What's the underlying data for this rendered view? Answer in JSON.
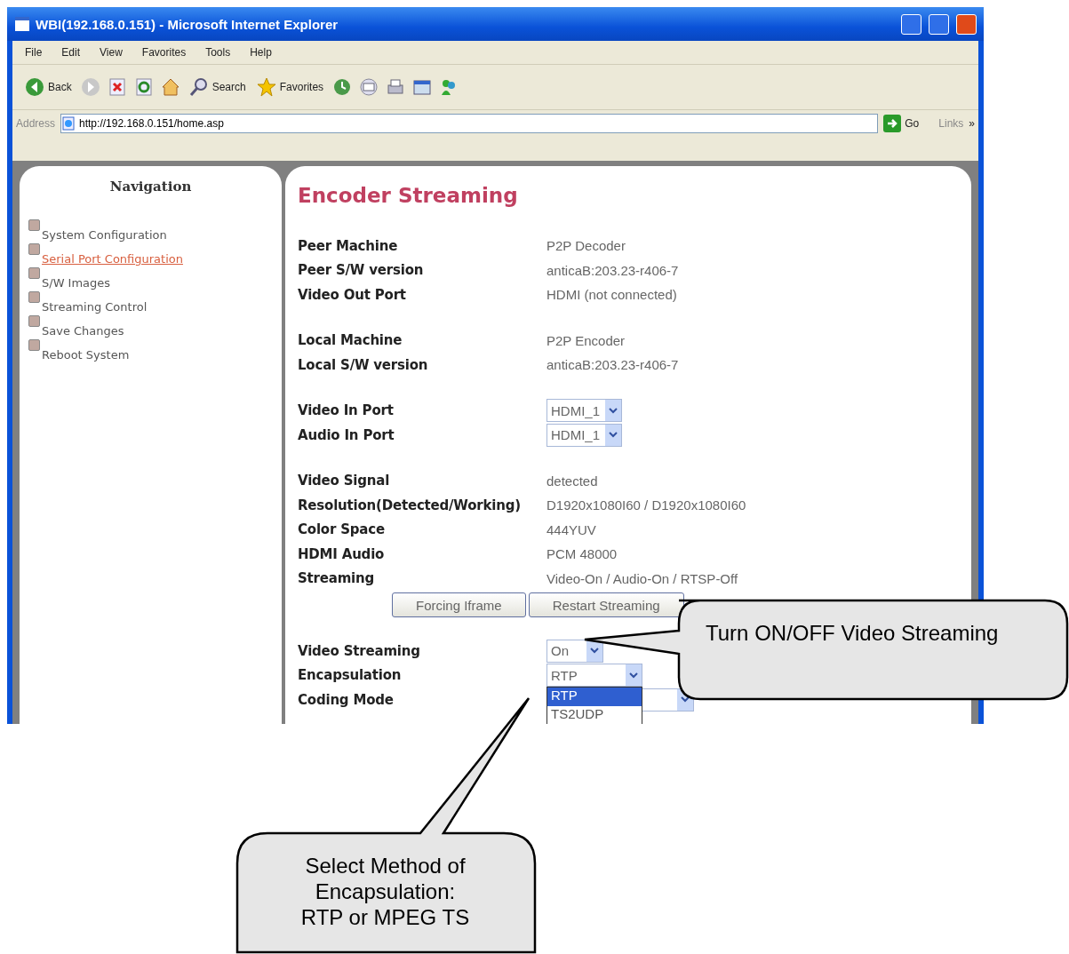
{
  "window": {
    "title": "WBI(192.168.0.151) - Microsoft Internet Explorer"
  },
  "menu": [
    "File",
    "Edit",
    "View",
    "Favorites",
    "Tools",
    "Help"
  ],
  "toolbar": [
    {
      "kind": "back",
      "label": "Back"
    },
    {
      "kind": "forward"
    },
    {
      "kind": "stop"
    },
    {
      "kind": "refresh"
    },
    {
      "kind": "home"
    },
    {
      "kind": "search",
      "label": "Search"
    },
    {
      "kind": "favorites",
      "label": "Favorites"
    },
    {
      "kind": "history"
    },
    {
      "kind": "mail"
    },
    {
      "kind": "print"
    },
    {
      "kind": "edit"
    },
    {
      "kind": "messenger"
    }
  ],
  "address_bar": {
    "label": "Address",
    "value": "http://192.168.0.151/home.asp",
    "go": "Go",
    "links": "Links",
    "more": "»"
  },
  "navigation": {
    "title": "Navigation",
    "items": [
      {
        "label": "System Configuration",
        "selected": false
      },
      {
        "label": "Serial Port Configuration",
        "selected": true
      },
      {
        "label": "S/W Images",
        "selected": false
      },
      {
        "label": "Streaming Control",
        "selected": false
      },
      {
        "label": "Save Changes",
        "selected": false
      },
      {
        "label": "Reboot System",
        "selected": false
      }
    ]
  },
  "content": {
    "title": "Encoder Streaming",
    "groups": [
      {
        "rows": [
          {
            "kind": "text",
            "label": "Peer Machine",
            "value": "P2P Decoder"
          },
          {
            "kind": "text",
            "label": "Peer S/W version",
            "value": "anticaB:203.23-r406-7"
          },
          {
            "kind": "text",
            "label": "Video Out Port",
            "value": "HDMI (not connected)"
          }
        ]
      },
      {
        "rows": [
          {
            "kind": "text",
            "label": "Local Machine",
            "value": "P2P Encoder"
          },
          {
            "kind": "text",
            "label": "Local S/W version",
            "value": "anticaB:203.23-r406-7"
          }
        ]
      },
      {
        "rows": [
          {
            "kind": "select",
            "label": "Video In Port",
            "value": "HDMI_1"
          },
          {
            "kind": "select",
            "label": "Audio In Port",
            "value": "HDMI_1"
          }
        ]
      },
      {
        "rows": [
          {
            "kind": "text",
            "label": "Video Signal",
            "value": "detected"
          },
          {
            "kind": "text",
            "label": "Resolution(Detected/Working)",
            "value": "D1920x1080I60 / D1920x1080I60"
          },
          {
            "kind": "text",
            "label": "Color Space",
            "value": "444YUV"
          },
          {
            "kind": "text",
            "label": "HDMI Audio",
            "value": "PCM 48000"
          },
          {
            "kind": "text",
            "label": "Streaming",
            "value": "Video-On / Audio-On / RTSP-Off"
          }
        ],
        "buttons": [
          "Forcing Iframe",
          "Restart Streaming"
        ]
      },
      {
        "rows": [
          {
            "kind": "select",
            "label": "Video Streaming",
            "value": "On"
          },
          {
            "kind": "select",
            "label": "Encapsulation",
            "value": "RTP",
            "expanded": true,
            "options": [
              {
                "label": "RTP",
                "selected": true
              },
              {
                "label": "TS2UDP",
                "selected": false
              }
            ]
          },
          {
            "kind": "select",
            "label": "Coding Mode"
          }
        ]
      }
    ]
  },
  "callouts": [
    {
      "text": "Turn ON/OFF Video Streaming"
    },
    {
      "text": "Select Method of\nEncapsulation:\nRTP or MPEG TS"
    }
  ]
}
